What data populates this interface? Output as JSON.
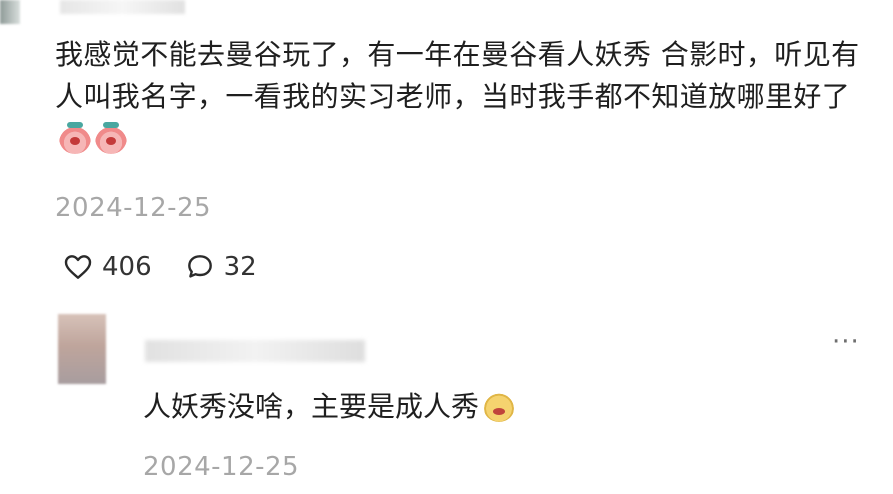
{
  "post_comment": {
    "text": "我感觉不能去曼谷玩了，有一年在曼谷看人妖秀 合影时，听见有人叫我名字，一看我的实习老师，当时我手都不知道放哪里好了",
    "date": "2024-12-25",
    "likes": "406",
    "comments": "32"
  },
  "reply": {
    "text": "人妖秀没啥，主要是成人秀",
    "date": "2024-12-25",
    "more_label": "···"
  }
}
